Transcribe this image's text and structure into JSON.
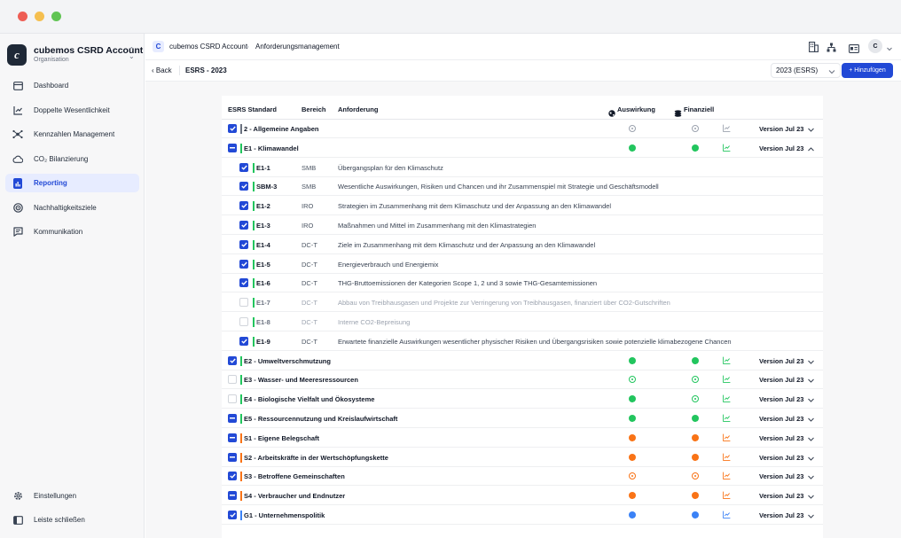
{
  "window": {
    "dots": [
      "#ee5e55",
      "#f5bf4f",
      "#61c454"
    ]
  },
  "sidebar": {
    "account": {
      "logo": "c",
      "name": "cubemos CSRD Account",
      "sub": "Organisation"
    },
    "items": [
      {
        "label": "Dashboard",
        "icon": "dashboard-icon",
        "active": false
      },
      {
        "label": "Doppelte Wesentlichkeit",
        "icon": "chart-icon",
        "active": false
      },
      {
        "label": "Kennzahlen Management",
        "icon": "network-icon",
        "active": false
      },
      {
        "label": "CO₂ Bilanzierung",
        "icon": "cloud-icon",
        "active": false
      },
      {
        "label": "Reporting",
        "icon": "report-icon",
        "active": true
      },
      {
        "label": "Nachhaltigkeitsziele",
        "icon": "target-icon",
        "active": false
      },
      {
        "label": "Kommunikation",
        "icon": "message-icon",
        "active": false
      }
    ],
    "bottom": [
      {
        "label": "Einstellungen",
        "icon": "gear-icon"
      },
      {
        "label": "Leiste schließen",
        "icon": "sidebar-icon"
      }
    ]
  },
  "header": {
    "crumb_icon": "C",
    "crumbs": [
      "cubemos CSRD Account",
      "Anforderungsmanagement"
    ],
    "avatar": "C"
  },
  "subbar": {
    "back": "‹ Back",
    "title": "ESRS - 2023",
    "year": "2023 (ESRS)",
    "add": "+ Hinzufügen"
  },
  "table": {
    "headers": {
      "standard": "ESRS Standard",
      "bereich": "Bereich",
      "anforderung": "Anforderung",
      "auswirkung": "Auswirkung",
      "finanziell": "Finanziell"
    },
    "rows": [
      {
        "kind": "group",
        "cb": "on",
        "bar": "#6b7280",
        "label": "2 - Allgemeine Angaben",
        "aus": "outline",
        "fin": "outline",
        "fincolor": "#9ca3af",
        "ver": "Version Jul 23",
        "chev": "down"
      },
      {
        "kind": "group",
        "cb": "partial",
        "bar": "#22c55e",
        "label": "E1 - Klimawandel",
        "aus": "fill",
        "fin": "fill",
        "fincolor": "#22c55e",
        "ver": "Version Jul 23",
        "chev": "up"
      },
      {
        "kind": "sub",
        "cb": "on",
        "code": "E1-1",
        "ber": "SMB",
        "text": "Übergangsplan für den Klimaschutz"
      },
      {
        "kind": "sub",
        "cb": "on",
        "code": "SBM-3",
        "ber": "SMB",
        "text": "Wesentliche Auswirkungen, Risiken und Chancen und ihr Zusammenspiel mit Strategie und Geschäftsmodell"
      },
      {
        "kind": "sub",
        "cb": "on",
        "code": "E1-2",
        "ber": "IRO",
        "text": "Strategien im Zusammenhang mit dem Klimaschutz und der Anpassung an den Klimawandel"
      },
      {
        "kind": "sub",
        "cb": "on",
        "code": "E1-3",
        "ber": "IRO",
        "text": "Maßnahmen und Mittel im Zusammenhang mit den Klimastrategien"
      },
      {
        "kind": "sub",
        "cb": "on",
        "code": "E1-4",
        "ber": "DC-T",
        "text": "Ziele im Zusammenhang mit dem Klimaschutz und der Anpassung an den Klimawandel"
      },
      {
        "kind": "sub",
        "cb": "on",
        "code": "E1-5",
        "ber": "DC-T",
        "text": "Energieverbrauch und Energiemix"
      },
      {
        "kind": "sub",
        "cb": "on",
        "code": "E1-6",
        "ber": "DC-T",
        "text": "THG-Bruttoemissionen der Kategorien Scope 1, 2 und 3 sowie THG-Gesamtemissionen"
      },
      {
        "kind": "sub",
        "cb": "off",
        "code": "E1-7",
        "ber": "DC-T",
        "text": "Abbau von Treibhausgasen und Projekte zur Verringerung von Treibhausgasen, finanziert über CO2-Gutschriften"
      },
      {
        "kind": "sub",
        "cb": "off",
        "code": "E1-8",
        "ber": "DC-T",
        "text": "Interne CO2-Bepreisung"
      },
      {
        "kind": "sub",
        "cb": "on",
        "code": "E1-9",
        "ber": "DC-T",
        "text": "Erwartete finanzielle Auswirkungen wesentlicher physischer Risiken und Übergangsrisiken sowie potenzielle klimabezogene Chancen"
      },
      {
        "kind": "group",
        "cb": "on",
        "bar": "#22c55e",
        "label": "E2 - Umweltverschmutzung",
        "aus": "fill",
        "fin": "fill",
        "fincolor": "#22c55e",
        "ver": "Version Jul 23",
        "chev": "down"
      },
      {
        "kind": "group",
        "cb": "off",
        "bar": "#22c55e",
        "label": "E3 - Wasser- und Meeresressourcen",
        "aus": "outline",
        "fin": "outline",
        "fincolor": "#22c55e",
        "ver": "Version Jul 23",
        "chev": "down"
      },
      {
        "kind": "group",
        "cb": "off",
        "bar": "#22c55e",
        "label": "E4 - Biologische Vielfalt und Ökosysteme",
        "aus": "fill",
        "fin": "outline",
        "fincolor": "#22c55e",
        "ver": "Version Jul 23",
        "chev": "down"
      },
      {
        "kind": "group",
        "cb": "partial",
        "bar": "#22c55e",
        "label": "E5 - Ressourcennutzung und Kreislaufwirtschaft",
        "aus": "fill",
        "fin": "fill",
        "fincolor": "#22c55e",
        "ver": "Version Jul 23",
        "chev": "down"
      },
      {
        "kind": "group",
        "cb": "partial",
        "bar": "#f97316",
        "label": "S1 - Eigene Belegschaft",
        "aus": "fill",
        "fin": "fill",
        "fincolor": "#f97316",
        "ver": "Version Jul 23",
        "chev": "down"
      },
      {
        "kind": "group",
        "cb": "partial",
        "bar": "#f97316",
        "label": "S2 - Arbeitskräfte in der Wertschöpfungskette",
        "aus": "fill",
        "fin": "fill",
        "fincolor": "#f97316",
        "ver": "Version Jul 23",
        "chev": "down"
      },
      {
        "kind": "group",
        "cb": "on",
        "bar": "#f97316",
        "label": "S3 - Betroffene Gemeinschaften",
        "aus": "outline",
        "fin": "outline",
        "fincolor": "#f97316",
        "ver": "Version Jul 23",
        "chev": "down"
      },
      {
        "kind": "group",
        "cb": "partial",
        "bar": "#f97316",
        "label": "S4 - Verbraucher und Endnutzer",
        "aus": "fill",
        "fin": "fill",
        "fincolor": "#f97316",
        "ver": "Version Jul 23",
        "chev": "down"
      },
      {
        "kind": "group",
        "cb": "on",
        "bar": "#3b82f6",
        "label": "G1 - Unternehmenspolitik",
        "aus": "fill",
        "fin": "fill",
        "fincolor": "#3b82f6",
        "ver": "Version Jul 23",
        "chev": "down"
      }
    ]
  }
}
